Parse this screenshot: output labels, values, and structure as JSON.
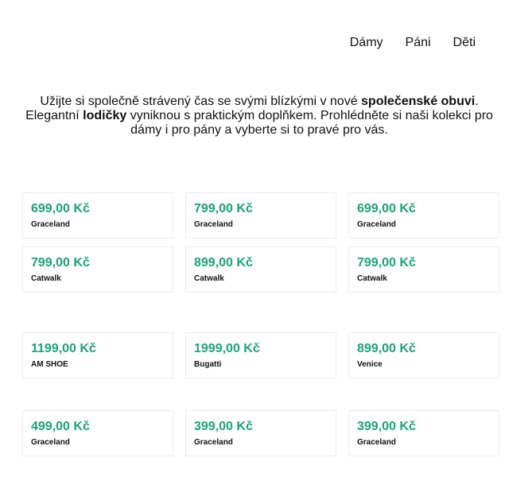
{
  "nav": {
    "items": [
      {
        "label": "Dámy"
      },
      {
        "label": "Páni"
      },
      {
        "label": "Děti"
      }
    ]
  },
  "intro": {
    "part1": "Užijte si společně strávený čas se svými blízkými v nové ",
    "bold1": "společenské obuvi",
    "part2": ". Elegantní ",
    "bold2": "lodičky",
    "part3": " vyniknou s praktickým doplňkem. Prohlédněte si naši kolekci pro dámy i pro pány a vyberte si to pravé pro vás."
  },
  "accent_color": "#1aa37a",
  "products": [
    [
      {
        "price": "699,00 Kč",
        "brand": "Graceland"
      },
      {
        "price": "799,00 Kč",
        "brand": "Graceland"
      },
      {
        "price": "699,00 Kč",
        "brand": "Graceland"
      }
    ],
    [
      {
        "price": "799,00 Kč",
        "brand": "Catwalk"
      },
      {
        "price": "899,00 Kč",
        "brand": "Catwalk"
      },
      {
        "price": "799,00 Kč",
        "brand": "Catwalk"
      }
    ],
    [
      {
        "price": "1199,00 Kč",
        "brand": "AM SHOE"
      },
      {
        "price": "1999,00 Kč",
        "brand": "Bugatti"
      },
      {
        "price": "899,00 Kč",
        "brand": "Venice"
      }
    ],
    [
      {
        "price": "499,00 Kč",
        "brand": "Graceland"
      },
      {
        "price": "399,00 Kč",
        "brand": "Graceland"
      },
      {
        "price": "399,00 Kč",
        "brand": "Graceland"
      }
    ]
  ]
}
